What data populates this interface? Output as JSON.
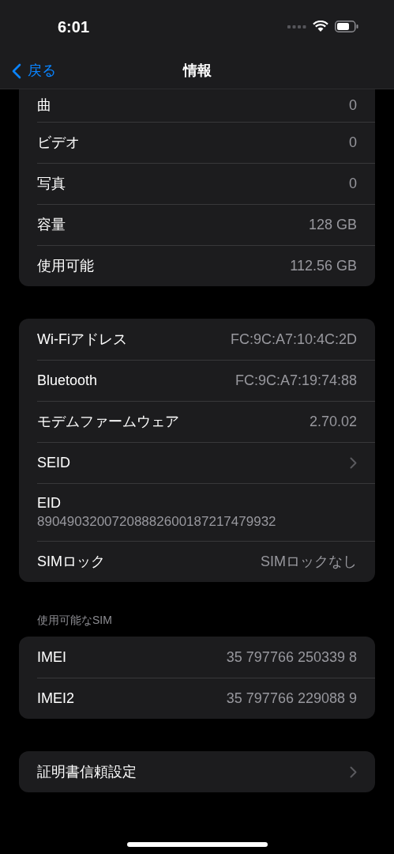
{
  "status_bar": {
    "time": "6:01"
  },
  "nav": {
    "back": "戻る",
    "title": "情報"
  },
  "groups": [
    {
      "cut_top": true,
      "rows": [
        {
          "kind": "value",
          "label": "曲",
          "value": "0"
        },
        {
          "kind": "value",
          "label": "ビデオ",
          "value": "0"
        },
        {
          "kind": "value",
          "label": "写真",
          "value": "0"
        },
        {
          "kind": "value",
          "label": "容量",
          "value": "128 GB"
        },
        {
          "kind": "value",
          "label": "使用可能",
          "value": "112.56 GB"
        }
      ]
    },
    {
      "rows": [
        {
          "kind": "value",
          "label": "Wi-Fiアドレス",
          "value": "FC:9C:A7:10:4C:2D"
        },
        {
          "kind": "value",
          "label": "Bluetooth",
          "value": "FC:9C:A7:19:74:88"
        },
        {
          "kind": "value",
          "label": "モデムファームウェア",
          "value": "2.70.02"
        },
        {
          "kind": "chevron",
          "label": "SEID"
        },
        {
          "kind": "stacked",
          "label": "EID",
          "value": "89049032007208882600187217479932"
        },
        {
          "kind": "value",
          "label": "SIMロック",
          "value": "SIMロックなし"
        }
      ]
    },
    {
      "header": "使用可能なSIM",
      "rows": [
        {
          "kind": "value",
          "label": "IMEI",
          "value": "35 797766 250339 8"
        },
        {
          "kind": "value",
          "label": "IMEI2",
          "value": "35 797766 229088 9"
        }
      ]
    },
    {
      "rows": [
        {
          "kind": "chevron",
          "label": "証明書信頼設定"
        }
      ]
    }
  ]
}
